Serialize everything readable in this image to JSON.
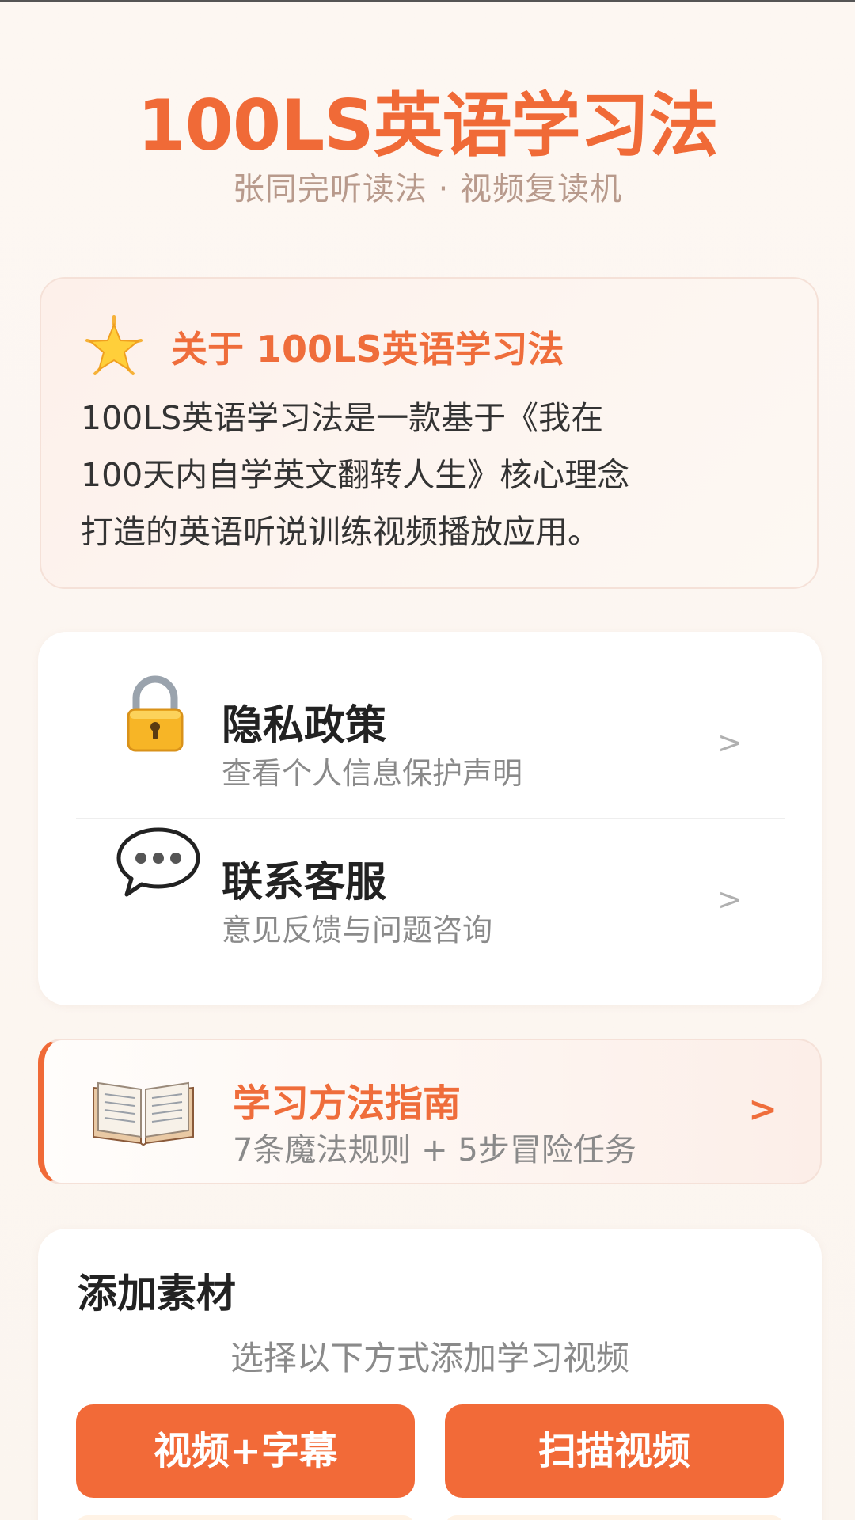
{
  "app": {
    "title": "100LS英语学习法",
    "subtitle": "张同完听读法 · 视频复读机"
  },
  "about": {
    "icon": "star-icon",
    "title": "关于 100LS英语学习法",
    "lines": [
      "100LS英语学习法是一款基于《我在",
      "100天内自学英文翻转人生》核心理念",
      "打造的英语听说训练视频播放应用。"
    ]
  },
  "menu": {
    "items": [
      {
        "icon": "lock-icon",
        "title": "隐私政策",
        "desc": "查看个人信息保护声明",
        "chevron": ">"
      },
      {
        "icon": "chat-bubble-icon",
        "title": "联系客服",
        "desc": "意见反馈与问题咨询",
        "chevron": ">"
      }
    ]
  },
  "guide": {
    "icon": "open-book-icon",
    "title": "学习方法指南",
    "desc": "7条魔法规则 + 5步冒险任务",
    "chevron": ">"
  },
  "add_material": {
    "title": "添加素材",
    "hint": "选择以下方式添加学习视频",
    "buttons": [
      {
        "label": "视频+字幕"
      },
      {
        "label": "扫描视频"
      }
    ]
  },
  "colors": {
    "accent": "#f06a37",
    "button": "#f26a38",
    "subtitle": "#b89a8c",
    "muted": "#8a8a8a"
  }
}
